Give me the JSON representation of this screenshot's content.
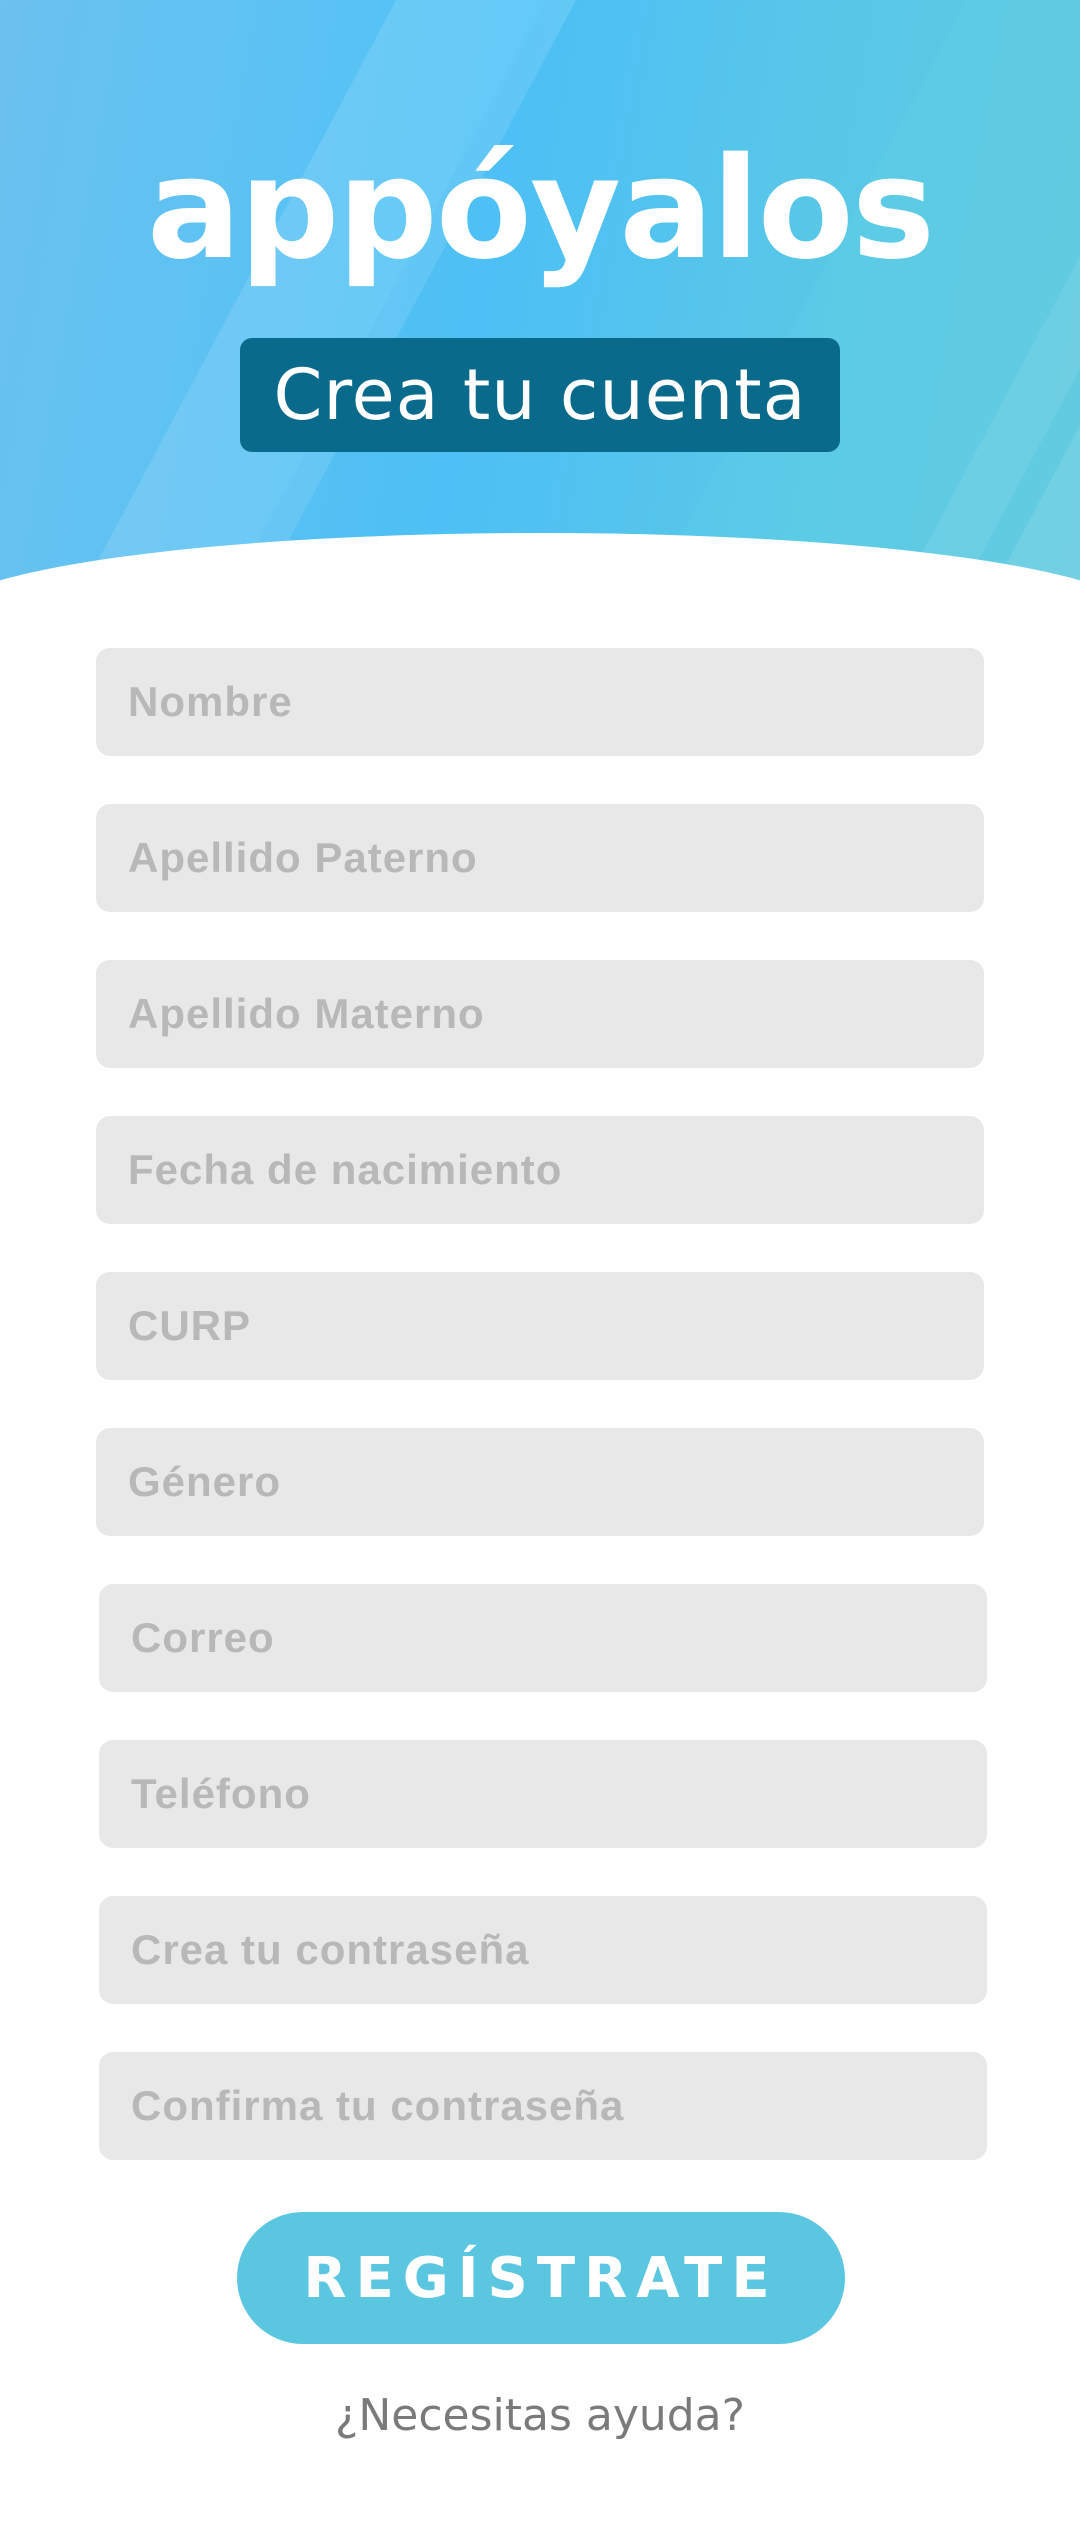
{
  "app": {
    "logo_text": "appóyalos",
    "title": "Crea tu cuenta"
  },
  "form": {
    "fields": [
      {
        "placeholder": "Nombre"
      },
      {
        "placeholder": "Apellido Paterno"
      },
      {
        "placeholder": "Apellido Materno"
      },
      {
        "placeholder": "Fecha de nacimiento"
      },
      {
        "placeholder": "CURP"
      },
      {
        "placeholder": "Género"
      },
      {
        "placeholder": "Correo"
      },
      {
        "placeholder": "Teléfono"
      },
      {
        "placeholder": "Crea tu contraseña"
      },
      {
        "placeholder": "Confirma tu contraseña"
      }
    ]
  },
  "actions": {
    "register_label": "REGÍSTRATE",
    "help_label": "¿Necesitas ayuda?"
  },
  "colors": {
    "header_blue": "#4fc3f7",
    "title_badge": "#0a6a8c",
    "button": "#5bc6e0",
    "field_bg": "#e8e8e8",
    "placeholder": "#b8b8b8"
  }
}
